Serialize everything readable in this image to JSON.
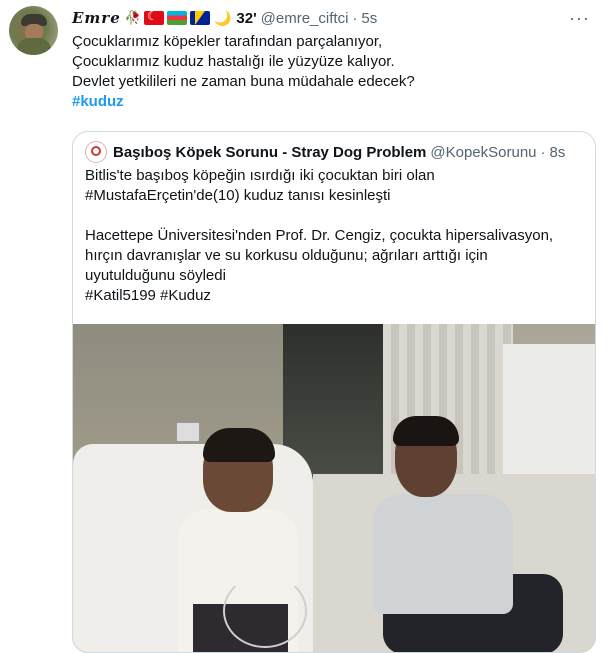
{
  "tweet": {
    "author_name": "Emre",
    "name_emojis": [
      "🥀"
    ],
    "flags": [
      "turkey",
      "azerbaijan",
      "bosnia"
    ],
    "crescent_emoji": "🌙",
    "name_number": "32'",
    "handle": "@emre_ciftci",
    "separator": "·",
    "time": "5s",
    "more_icon": "more-horizontal-icon",
    "more_label": "···",
    "lines": [
      "Çocuklarımız köpekler tarafından parçalanıyor,",
      "Çocuklarımız kuduz hastalığı ile yüzyüze kalıyor.",
      "Devlet yetkilileri ne zaman buna müdahale edecek?"
    ],
    "hashtag": "#kuduz"
  },
  "quote": {
    "author_name": "Başıboş Köpek Sorunu - Stray Dog Problem",
    "handle": "@KopekSorunu",
    "separator": "·",
    "time": "8s",
    "lines": [
      "Bitlis'te başıboş köpeğin ısırdığı iki çocuktan biri olan",
      "#MustafaErçetin'de(10) kuduz tanısı kesinleşti",
      "",
      "Hacettepe Üniversitesi'nden Prof. Dr. Cengiz, çocukta hipersalivasyon,",
      "hırçın davranışlar ve su korkusu olduğunu; ağrıları arttığı için",
      "uyutulduğunu söyledi",
      "#Katil5199 #Kuduz"
    ]
  },
  "colors": {
    "accent": "#1d9bf0",
    "secondary_text": "#536471",
    "border": "#cfd9de"
  }
}
